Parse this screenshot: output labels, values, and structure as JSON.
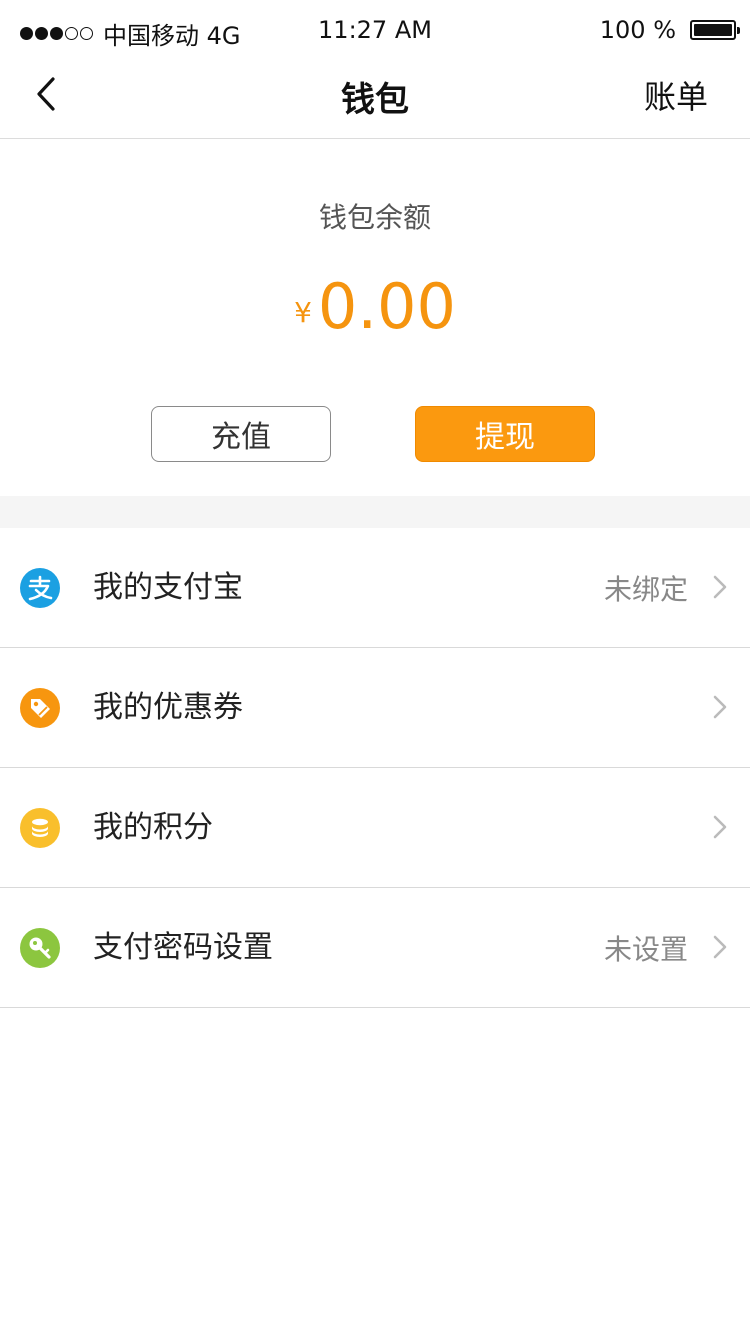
{
  "status_bar": {
    "carrier": "中国移动 4G",
    "time": "11:27 AM",
    "battery_text": "100 %",
    "signal_bars": 3,
    "signal_total": 5,
    "battery_level": 1.0
  },
  "nav": {
    "back_icon": "chevron-left-icon",
    "title": "钱包",
    "right_label": "账单"
  },
  "balance": {
    "label": "钱包余额",
    "currency": "¥",
    "amount": "0.00",
    "color": "#f5940f"
  },
  "actions": {
    "recharge_label": "充值",
    "withdraw_label": "提现",
    "accent_color": "#fb990f"
  },
  "menu": {
    "items": [
      {
        "label": "我的支付宝",
        "status": "未绑定",
        "icon": "alipay-icon",
        "color": "#1ba0e2"
      },
      {
        "label": "我的优惠券",
        "status": "",
        "icon": "coupon-tag-icon",
        "color": "#f7960f"
      },
      {
        "label": "我的积分",
        "status": "",
        "icon": "coins-icon",
        "color": "#f9bf2c"
      },
      {
        "label": "支付密码设置",
        "status": "未设置",
        "icon": "key-icon",
        "color": "#8cc63f"
      }
    ]
  }
}
